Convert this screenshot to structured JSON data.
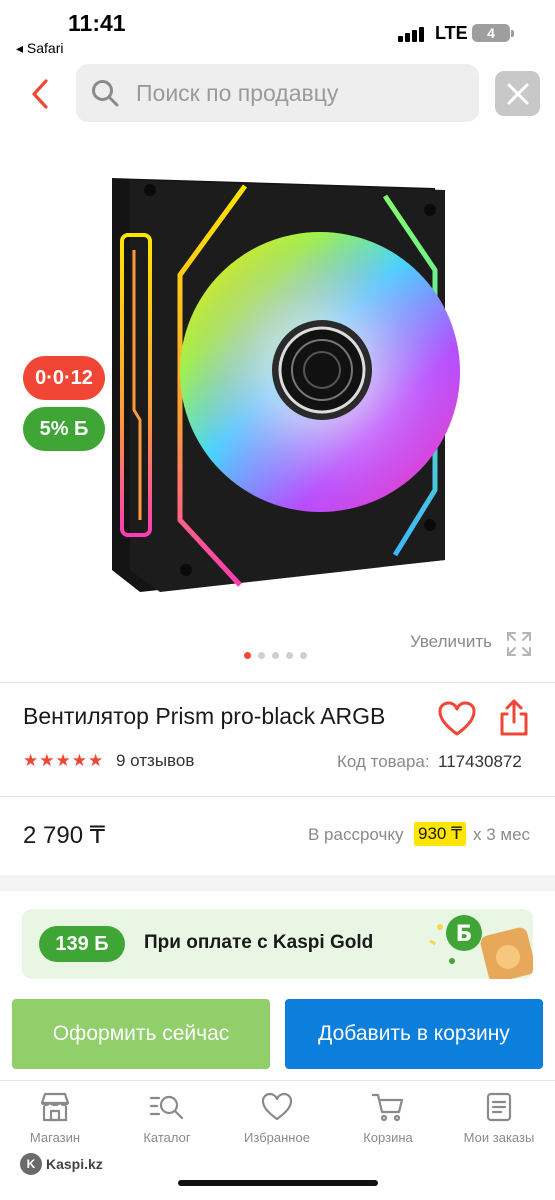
{
  "status_bar": {
    "time": "11:41",
    "back_app": "◂ Safari",
    "network": "LTE",
    "battery": "4"
  },
  "header": {
    "search_placeholder": "Поиск по продавцу"
  },
  "gallery": {
    "installment_badge": "0·0·12",
    "bonus_badge": "5% Б",
    "zoom_label": "Увеличить",
    "image_count": 5,
    "active_index": 0
  },
  "product": {
    "title": "Вентилятор Prism pro-black ARGB",
    "rating": 5,
    "reviews": "9 отзывов",
    "code_label": "Код товара:",
    "code_value": "117430872"
  },
  "pricing": {
    "price": "2 790 ₸",
    "installment_label": "В рассрочку",
    "installment_amount": "930 ₸",
    "installment_months": "х 3 мес"
  },
  "gold_banner": {
    "bonus": "139 Б",
    "text": "При оплате с Kaspi Gold"
  },
  "actions": {
    "buy_now": "Оформить сейчас",
    "add_to_cart": "Добавить в корзину"
  },
  "tab_bar": {
    "items": [
      {
        "label": "Магазин",
        "icon": "store-icon"
      },
      {
        "label": "Каталог",
        "icon": "catalog-icon"
      },
      {
        "label": "Избранное",
        "icon": "heart-icon"
      },
      {
        "label": "Корзина",
        "icon": "cart-icon"
      },
      {
        "label": "Мои заказы",
        "icon": "orders-icon"
      }
    ]
  },
  "footer": {
    "brand": "Kaspi.kz",
    "brand_logo": "K"
  },
  "colors": {
    "brand_red": "#f14635",
    "brand_green": "#3fa535",
    "cart_blue": "#0b7fdb",
    "highlight_yellow": "#ffe600"
  }
}
